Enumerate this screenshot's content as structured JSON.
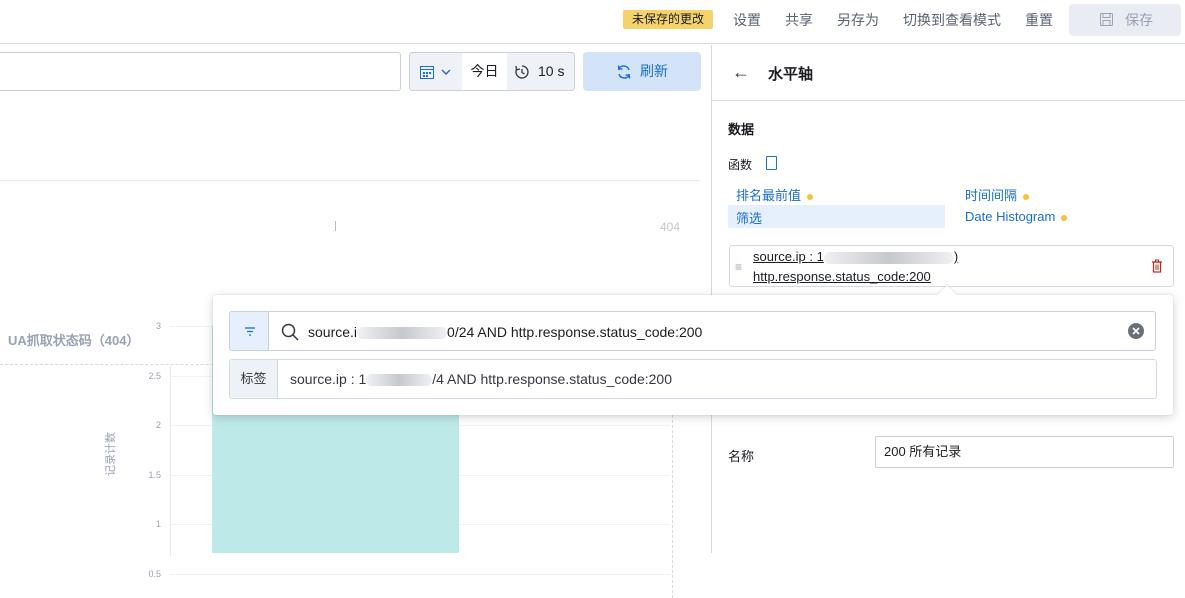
{
  "topbar": {
    "unsaved_badge": "未保存的更改",
    "links": [
      "设置",
      "共享",
      "另存为",
      "切换到查看模式",
      "重置"
    ],
    "save_label": "保存"
  },
  "toolbar": {
    "date_quick": "今日",
    "refresh_interval": "10 s",
    "refresh_label": "刷新"
  },
  "chart": {
    "title": "UA抓取状态码（404）",
    "tick_top": "404",
    "y_label": "记录计数"
  },
  "chart_data": {
    "type": "bar",
    "title": "UA抓取状态码（404）",
    "ylabel": "记录计数",
    "ylim": [
      0,
      3
    ],
    "y_ticks": [
      "3",
      "2.5",
      "2",
      "1.5",
      "1",
      "0.5"
    ],
    "values": [
      3
    ]
  },
  "panel": {
    "back_icon": "arrow-left-icon",
    "title": "水平轴",
    "section_data": "数据",
    "functions_label": "函数",
    "functions": [
      {
        "label": "排名最前值"
      },
      {
        "label": "时间间隔"
      },
      {
        "label": "筛选"
      },
      {
        "label": "Date Histogram"
      }
    ],
    "filter_line1": "source.ip : 1",
    "filter_line1_end": ")",
    "filter_line2": "http.response.status_code:200",
    "name_label": "名称",
    "name_value": "200 所有记录"
  },
  "popover": {
    "query_prefix": "source.i",
    "query_suffix": "0/24 AND http.response.status_code:200",
    "tag_label": "标签",
    "tag_prefix": "source.ip : 1",
    "tag_suffix": "/4 AND http.response.status_code:200"
  },
  "colors": {
    "accent": "#1a6dd3",
    "badge": "#f5d36b",
    "bar": "#bde9e8"
  }
}
